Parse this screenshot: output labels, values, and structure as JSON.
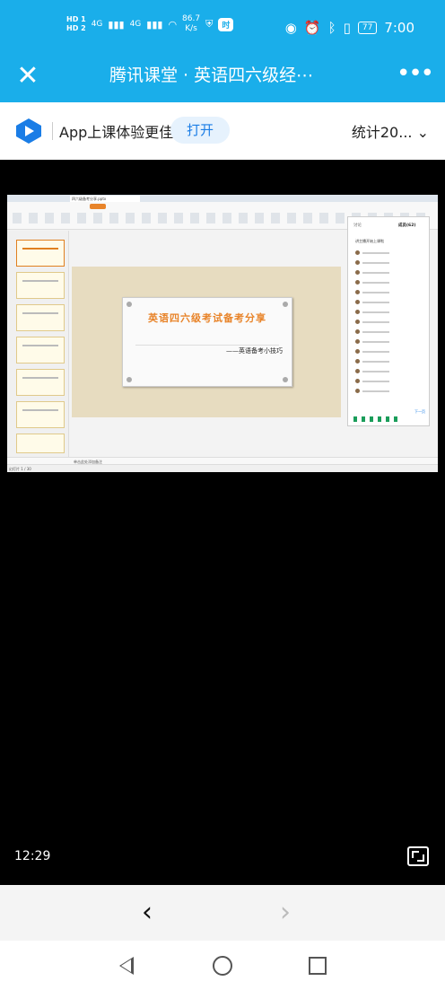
{
  "status_bar": {
    "hd1": "HD 1",
    "hd2": "HD 2",
    "net1": "4G",
    "net2": "4G",
    "speed_value": "86.7",
    "speed_unit": "K/s",
    "app_pill": "时",
    "battery": "77",
    "time": "7:00"
  },
  "app_bar": {
    "title": "腾讯课堂 · 英语四六级经⋯",
    "close_icon": "close-icon",
    "more_icon": "more-icon"
  },
  "banner": {
    "text": "App上课体验更佳",
    "open_label": "打开",
    "stats_label": "统计20...",
    "logo_color": "#1a7de6"
  },
  "presentation": {
    "doc_tab": "四六级备考分享.pptx",
    "slide_title": "英语四六级考试备考分享",
    "slide_subtitle": "——英语备考小技巧",
    "panel_tab_left": "讨论",
    "panel_tab_right": "成员(62)",
    "panel_header": "讲主播开始上课啦",
    "next_page": "下一页",
    "status_left": "幻灯片 1 / 30",
    "notes_placeholder": "单击此处添加备注"
  },
  "video": {
    "elapsed": "12:29"
  },
  "colors": {
    "header_blue": "#1aaeea",
    "slide_title_orange": "#e8842a"
  }
}
